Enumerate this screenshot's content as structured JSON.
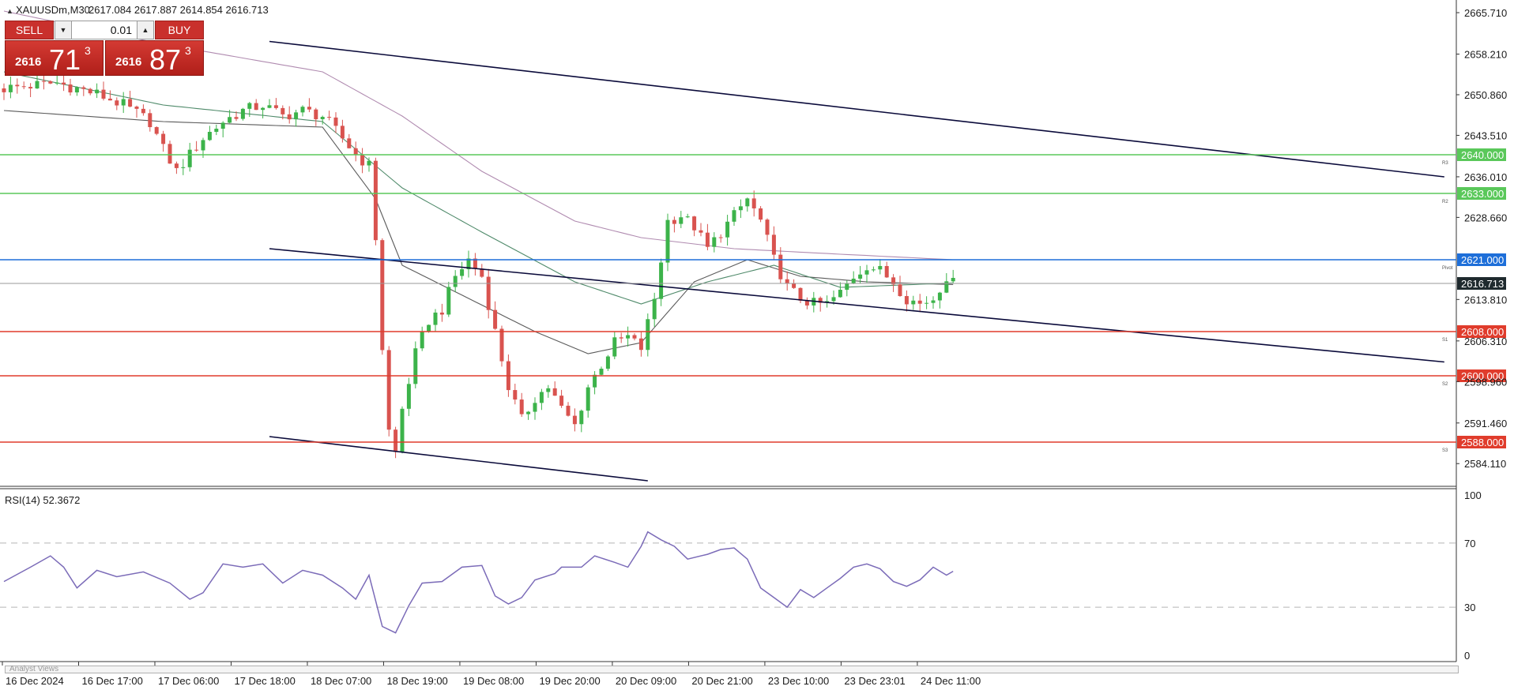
{
  "header": {
    "symbol": "XAUUSDm,M30",
    "ohlc": "2617.084 2617.887 2614.854 2616.713"
  },
  "trade_panel": {
    "sell_label": "SELL",
    "buy_label": "BUY",
    "lot_value": "0.01",
    "sell_price": {
      "small": "2616",
      "big": "71",
      "sup": "3"
    },
    "buy_price": {
      "small": "2616",
      "big": "87",
      "sup": "3"
    }
  },
  "price_axis": {
    "labels": [
      "2665.710",
      "2658.210",
      "2650.860",
      "2643.510",
      "2636.010",
      "2628.660",
      "2613.810",
      "2606.310",
      "2598.960",
      "2591.460",
      "2584.110"
    ]
  },
  "levels": [
    {
      "price": "2640.000",
      "color": "#5ac85a",
      "tag": "R3"
    },
    {
      "price": "2633.000",
      "color": "#5ac85a",
      "tag": "R2"
    },
    {
      "price": "2621.000",
      "color": "#1e6fd9",
      "tag": "Pivot"
    },
    {
      "price": "2608.000",
      "color": "#e03c2c",
      "tag": "S1"
    },
    {
      "price": "2600.000",
      "color": "#e03c2c",
      "tag": "S2"
    },
    {
      "price": "2588.000",
      "color": "#e03c2c",
      "tag": "S3"
    }
  ],
  "current_price": "2616.713",
  "rsi": {
    "label": "RSI(14) 52.3672",
    "axis": [
      "100",
      "70",
      "30",
      "0"
    ]
  },
  "time_axis": {
    "labels": [
      "16 Dec 2024",
      "16 Dec 17:00",
      "17 Dec 06:00",
      "17 Dec 18:00",
      "18 Dec 07:00",
      "18 Dec 19:00",
      "19 Dec 08:00",
      "19 Dec 20:00",
      "20 Dec 09:00",
      "20 Dec 21:00",
      "23 Dec 10:00",
      "23 Dec 23:01",
      "24 Dec 11:00"
    ]
  },
  "bottom_label": "Analyst Views",
  "colors": {
    "bull": "#3cb34a",
    "bear": "#d9534f",
    "rsi_line": "#7b6bb8",
    "ma_fast": "#5b5b5b",
    "ma_mid": "#4f8a6a",
    "ma_slow": "#b08bb0",
    "channel": "#0a0a3a"
  },
  "chart_data": {
    "type": "candlestick",
    "symbol": "XAUUSDm",
    "timeframe": "M30",
    "ylim": [
      2580.0,
      2668.0
    ],
    "close_path": [
      [
        0,
        2652.0
      ],
      [
        8,
        2653.0
      ],
      [
        14,
        2651.0
      ],
      [
        18,
        2649.0
      ],
      [
        22,
        2646.0
      ],
      [
        24,
        2641.0
      ],
      [
        26,
        2637.0
      ],
      [
        28,
        2640.0
      ],
      [
        30,
        2643.0
      ],
      [
        33,
        2646.0
      ],
      [
        36,
        2648.0
      ],
      [
        39,
        2649.0
      ],
      [
        42,
        2647.0
      ],
      [
        45,
        2648.0
      ],
      [
        48,
        2647.0
      ],
      [
        51,
        2643.0
      ],
      [
        53,
        2640.0
      ],
      [
        55,
        2638.0
      ],
      [
        56,
        2625.0
      ],
      [
        57,
        2605.0
      ],
      [
        58,
        2590.0
      ],
      [
        59,
        2586.0
      ],
      [
        60,
        2594.0
      ],
      [
        62,
        2604.0
      ],
      [
        64,
        2610.0
      ],
      [
        66,
        2612.0
      ],
      [
        68,
        2618.0
      ],
      [
        70,
        2621.0
      ],
      [
        72,
        2618.0
      ],
      [
        74,
        2608.0
      ],
      [
        76,
        2598.0
      ],
      [
        78,
        2592.0
      ],
      [
        80,
        2596.0
      ],
      [
        82,
        2598.0
      ],
      [
        84,
        2594.0
      ],
      [
        86,
        2591.0
      ],
      [
        88,
        2598.0
      ],
      [
        90,
        2602.0
      ],
      [
        92,
        2606.0
      ],
      [
        94,
        2607.0
      ],
      [
        96,
        2605.0
      ],
      [
        98,
        2614.0
      ],
      [
        100,
        2628.0
      ],
      [
        102,
        2629.0
      ],
      [
        104,
        2627.0
      ],
      [
        106,
        2623.0
      ],
      [
        108,
        2626.0
      ],
      [
        110,
        2629.0
      ],
      [
        112,
        2632.0
      ],
      [
        114,
        2628.0
      ],
      [
        116,
        2621.0
      ],
      [
        118,
        2616.0
      ],
      [
        120,
        2614.0
      ],
      [
        122,
        2613.0
      ],
      [
        124,
        2613.0
      ],
      [
        126,
        2615.0
      ],
      [
        128,
        2618.0
      ],
      [
        130,
        2620.0
      ],
      [
        132,
        2619.0
      ],
      [
        134,
        2617.0
      ],
      [
        136,
        2614.0
      ],
      [
        138,
        2613.0
      ],
      [
        140,
        2614.0
      ],
      [
        142,
        2618.0
      ],
      [
        143,
        2616.7
      ]
    ],
    "ma_fast": [
      [
        0,
        2648.0
      ],
      [
        24,
        2646.0
      ],
      [
        48,
        2645.0
      ],
      [
        56,
        2632.0
      ],
      [
        60,
        2620.0
      ],
      [
        70,
        2614.0
      ],
      [
        80,
        2608.0
      ],
      [
        88,
        2604.0
      ],
      [
        96,
        2606.0
      ],
      [
        104,
        2617.0
      ],
      [
        112,
        2621.0
      ],
      [
        120,
        2618.0
      ],
      [
        130,
        2617.0
      ],
      [
        143,
        2616.5
      ]
    ],
    "ma_mid": [
      [
        0,
        2655.0
      ],
      [
        24,
        2649.0
      ],
      [
        48,
        2646.0
      ],
      [
        60,
        2634.0
      ],
      [
        72,
        2626.0
      ],
      [
        86,
        2617.0
      ],
      [
        96,
        2613.0
      ],
      [
        106,
        2617.0
      ],
      [
        116,
        2620.0
      ],
      [
        126,
        2616.0
      ],
      [
        143,
        2616.8
      ]
    ],
    "ma_slow": [
      [
        0,
        2666.0
      ],
      [
        24,
        2660.0
      ],
      [
        48,
        2655.0
      ],
      [
        60,
        2647.0
      ],
      [
        72,
        2637.0
      ],
      [
        86,
        2628.0
      ],
      [
        96,
        2625.0
      ],
      [
        110,
        2623.0
      ],
      [
        126,
        2622.0
      ],
      [
        143,
        2621.0
      ]
    ],
    "levels": [
      2640.0,
      2633.0,
      2621.0,
      2608.0,
      2600.0,
      2588.0
    ],
    "channels": [
      {
        "x": [
          40,
          217
        ],
        "y": [
          2660.5,
          2636.0
        ]
      },
      {
        "x": [
          40,
          217
        ],
        "y": [
          2623.0,
          2602.5
        ]
      },
      {
        "x": [
          40,
          97
        ],
        "y": [
          2589.0,
          2581.0
        ]
      }
    ],
    "rsi": {
      "ylim": [
        0,
        100
      ],
      "levels": [
        70,
        30
      ],
      "values": [
        [
          0,
          46
        ],
        [
          4,
          55
        ],
        [
          7,
          62
        ],
        [
          9,
          55
        ],
        [
          11,
          42
        ],
        [
          14,
          53
        ],
        [
          17,
          49
        ],
        [
          21,
          52
        ],
        [
          25,
          45
        ],
        [
          28,
          35
        ],
        [
          30,
          39
        ],
        [
          33,
          57
        ],
        [
          36,
          55
        ],
        [
          39,
          57
        ],
        [
          42,
          45
        ],
        [
          45,
          53
        ],
        [
          48,
          50
        ],
        [
          51,
          42
        ],
        [
          53,
          35
        ],
        [
          55,
          50
        ],
        [
          57,
          18
        ],
        [
          59,
          14
        ],
        [
          61,
          31
        ],
        [
          63,
          45
        ],
        [
          66,
          46
        ],
        [
          69,
          55
        ],
        [
          72,
          56
        ],
        [
          74,
          37
        ],
        [
          76,
          32
        ],
        [
          78,
          36
        ],
        [
          80,
          47
        ],
        [
          83,
          51
        ],
        [
          84,
          55
        ],
        [
          87,
          55
        ],
        [
          89,
          62
        ],
        [
          92,
          58
        ],
        [
          94,
          55
        ],
        [
          96,
          68
        ],
        [
          97,
          77
        ],
        [
          99,
          72
        ],
        [
          101,
          68
        ],
        [
          103,
          60
        ],
        [
          106,
          63
        ],
        [
          108,
          66
        ],
        [
          110,
          67
        ],
        [
          112,
          60
        ],
        [
          114,
          42
        ],
        [
          116,
          36
        ],
        [
          118,
          30
        ],
        [
          120,
          41
        ],
        [
          122,
          36
        ],
        [
          124,
          42
        ],
        [
          126,
          48
        ],
        [
          128,
          55
        ],
        [
          130,
          57
        ],
        [
          132,
          54
        ],
        [
          134,
          46
        ],
        [
          136,
          43
        ],
        [
          138,
          47
        ],
        [
          140,
          55
        ],
        [
          142,
          50
        ],
        [
          143,
          52.4
        ]
      ]
    },
    "x_ticks": [
      "16 Dec 2024",
      "16 Dec 17:00",
      "17 Dec 06:00",
      "17 Dec 18:00",
      "18 Dec 07:00",
      "18 Dec 19:00",
      "19 Dec 08:00",
      "19 Dec 20:00",
      "20 Dec 09:00",
      "20 Dec 21:00",
      "23 Dec 10:00",
      "23 Dec 23:01",
      "24 Dec 11:00"
    ],
    "y_ticks": [
      2665.71,
      2658.21,
      2650.86,
      2643.51,
      2636.01,
      2628.66,
      2613.81,
      2606.31,
      2598.96,
      2591.46,
      2584.11
    ]
  }
}
